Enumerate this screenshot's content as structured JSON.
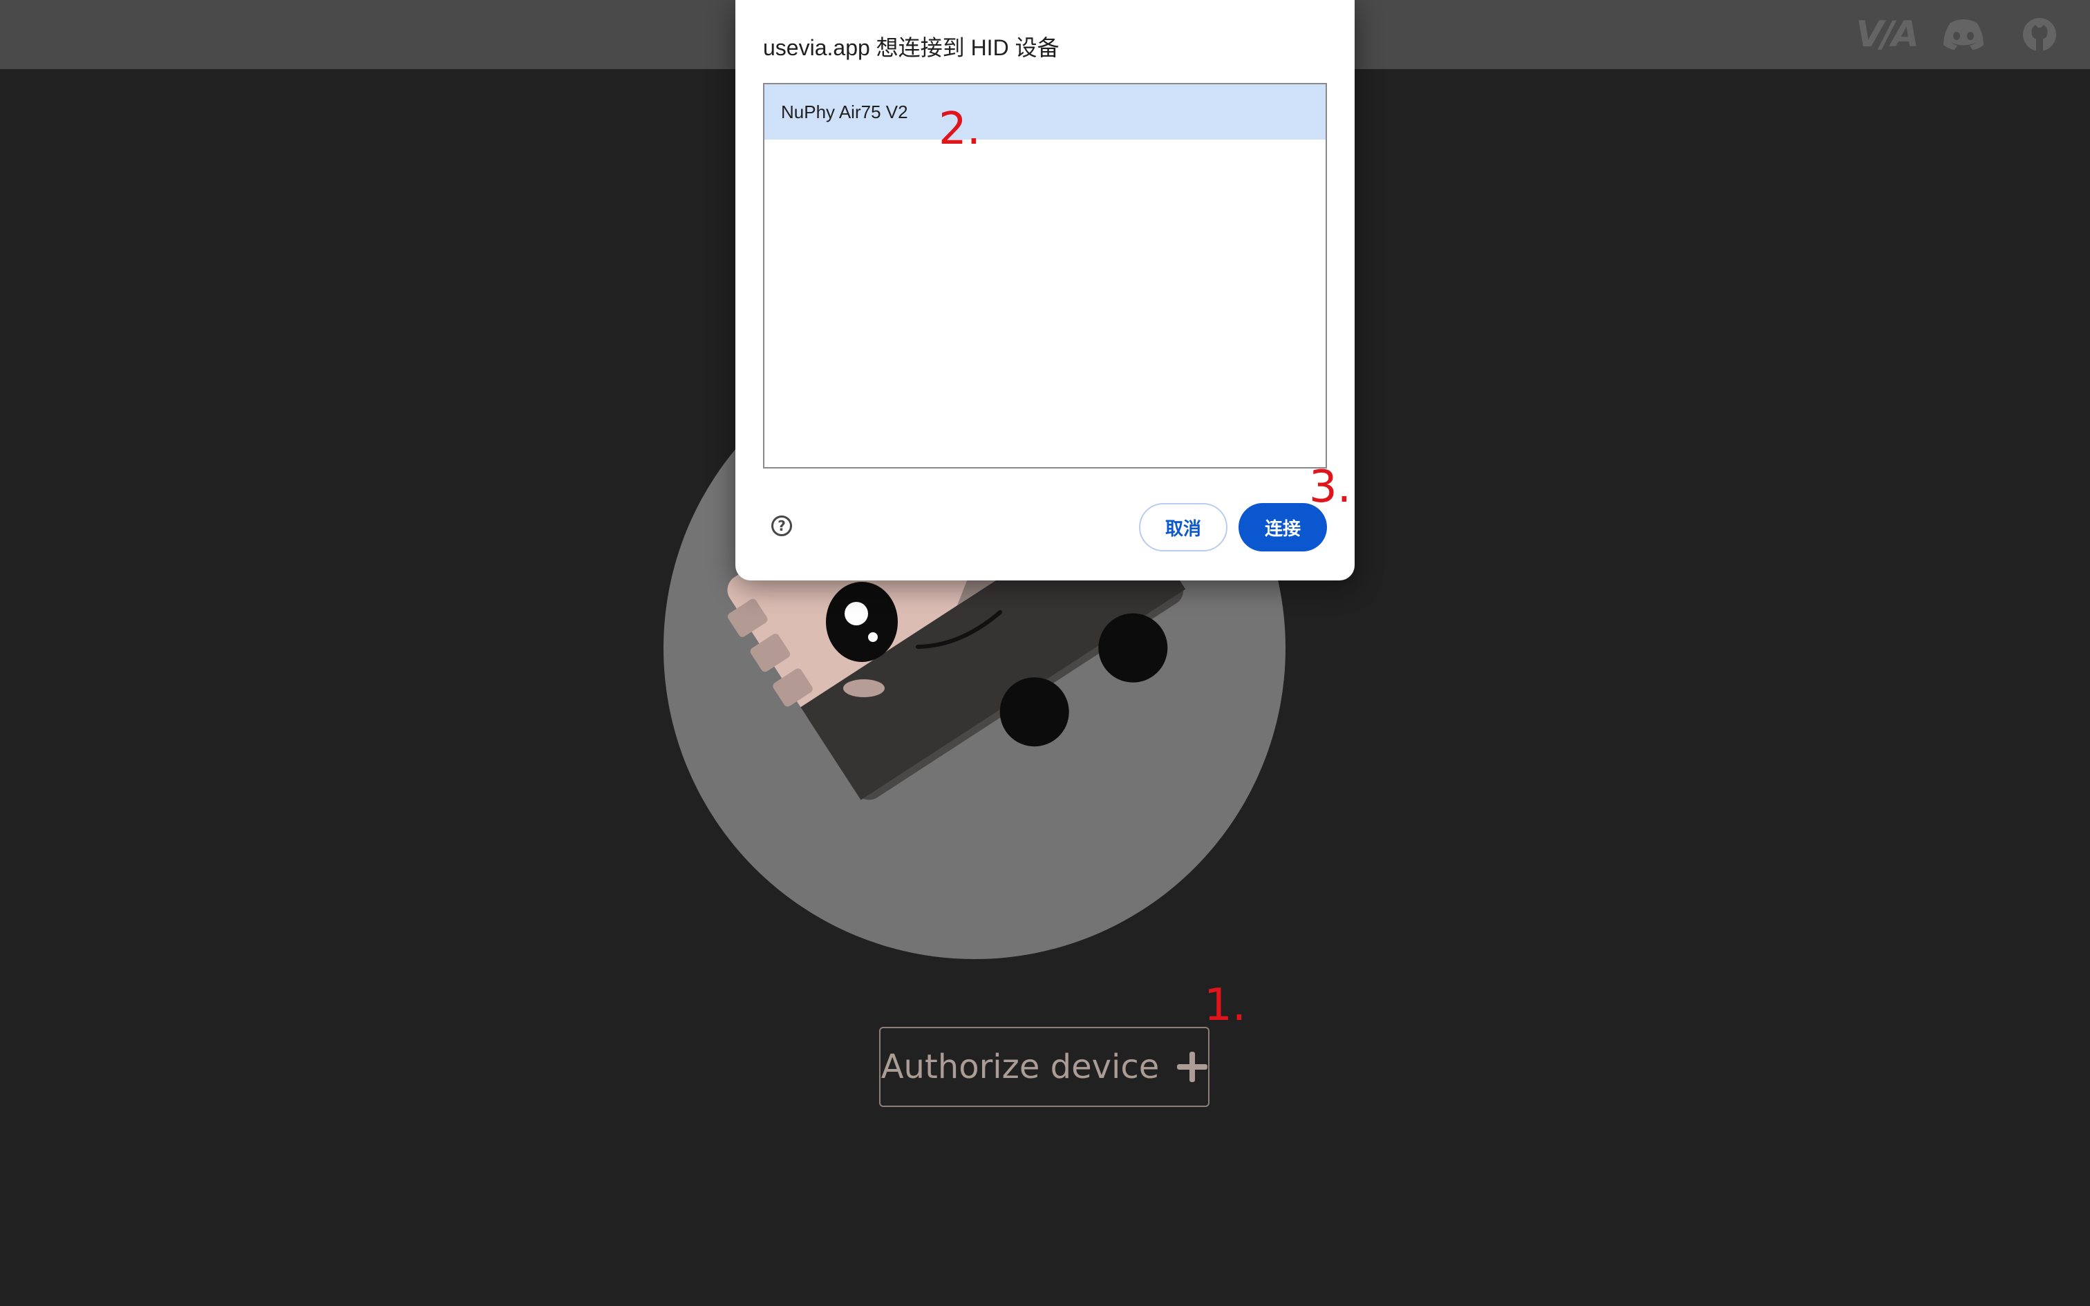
{
  "header": {
    "logo_text": "V/A",
    "icons": [
      "via-logo",
      "discord-icon",
      "github-icon"
    ]
  },
  "main": {
    "authorize_label": "Authorize device",
    "plus_icon": "plus-icon",
    "accent_color": "#ab9c96"
  },
  "dialog": {
    "title": "usevia.app 想连接到 HID 设备",
    "devices": [
      "NuPhy Air75 V2"
    ],
    "selected_index": 0,
    "help_icon": "?",
    "cancel_label": "取消",
    "connect_label": "连接",
    "primary_color": "#0b57d0"
  },
  "annotations": {
    "step1": "1.",
    "step2": "2.",
    "step3": "3.",
    "color": "#e0141b"
  }
}
